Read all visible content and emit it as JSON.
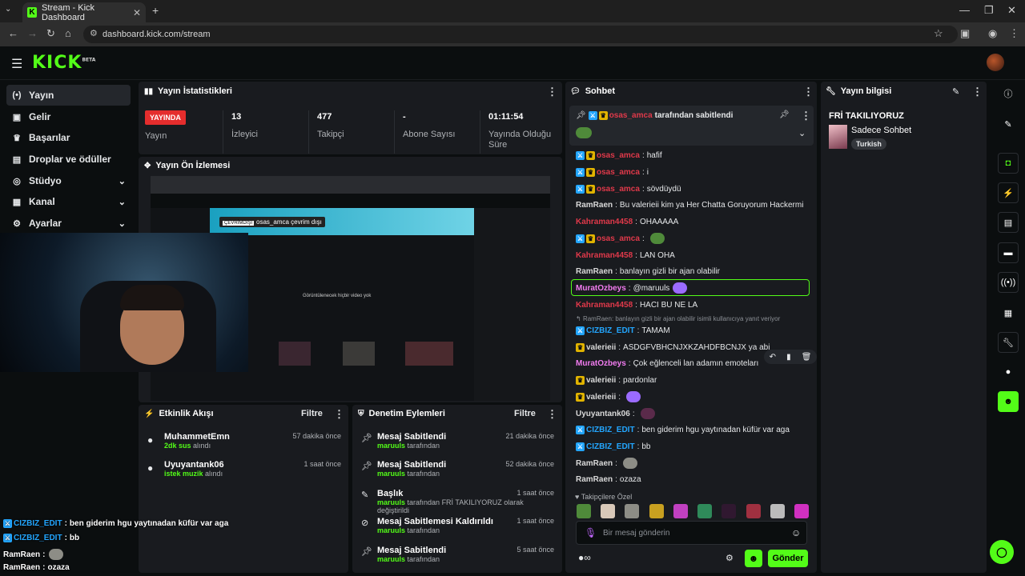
{
  "browser": {
    "tab_title": "Stream - Kick Dashboard",
    "url": "dashboard.kick.com/stream",
    "new_tab": "+"
  },
  "header": {
    "logo": "KICK",
    "logo_sup": "BETA"
  },
  "sidebar": {
    "items": [
      {
        "label": "Yayın",
        "icon": "broadcast-icon"
      },
      {
        "label": "Gelir",
        "icon": "revenue-icon"
      },
      {
        "label": "Başarılar",
        "icon": "trophy-icon"
      },
      {
        "label": "Droplar ve ödüller",
        "icon": "gift-icon"
      },
      {
        "label": "Stüdyo",
        "icon": "studio-icon"
      },
      {
        "label": "Kanal",
        "icon": "channel-icon"
      },
      {
        "label": "Ayarlar",
        "icon": "settings-icon"
      }
    ]
  },
  "stats": {
    "title": "Yayın İstatistikleri",
    "status_badge": "YAYINDA",
    "status_label": "Yayın",
    "items": [
      {
        "value": "13",
        "label": "İzleyici"
      },
      {
        "value": "477",
        "label": "Takipçi"
      },
      {
        "value": "-",
        "label": "Abone Sayısı"
      },
      {
        "value": "01:11:54",
        "label": "Yayında Olduğu Süre"
      }
    ]
  },
  "preview": {
    "title": "Yayın Ön İzlemesi",
    "offline_text": "osas_amca çevrim dışı",
    "offline_tag": "ÇEVRİMDIŞI",
    "no_video": "Görüntülenecek hiçbir video yok"
  },
  "activity": {
    "title": "Etkinlik Akışı",
    "filter": "Filtre",
    "items": [
      {
        "name": "MuhammetEmn",
        "amount": "2dk sus",
        "suffix": "alındı",
        "time": "57 dakika önce"
      },
      {
        "name": "Uyuyantank06",
        "amount": "istek muzik",
        "suffix": "alındı",
        "time": "1 saat önce"
      }
    ]
  },
  "moderation": {
    "title": "Denetim Eylemleri",
    "filter": "Filtre",
    "items": [
      {
        "action": "Mesaj Sabitlendi",
        "user": "maruuls",
        "suffix": "tarafından",
        "time": "21 dakika önce"
      },
      {
        "action": "Mesaj Sabitlendi",
        "user": "maruuls",
        "suffix": "tarafından",
        "time": "52 dakika önce"
      },
      {
        "action": "Başlık",
        "user": "maruuls",
        "suffix": "tarafından FRİ TAKILIYORUZ olarak değiştirildi",
        "time": "1 saat önce"
      },
      {
        "action": "Mesaj Sabitlemesi Kaldırıldı",
        "user": "maruuls",
        "suffix": "tarafından",
        "time": "1 saat önce"
      },
      {
        "action": "Mesaj Sabitlendi",
        "user": "maruuls",
        "suffix": "tarafından",
        "time": "5 saat önce"
      }
    ]
  },
  "chat": {
    "title": "Sohbet",
    "pinned_by": "osas_amca",
    "pinned_suffix": "tarafından sabitlendi",
    "messages": [
      {
        "user": "osas_amca",
        "color": "#e0394a",
        "mod": true,
        "sub": true,
        "text": "hafif"
      },
      {
        "user": "osas_amca",
        "color": "#e0394a",
        "mod": true,
        "sub": true,
        "text": "i"
      },
      {
        "user": "osas_amca",
        "color": "#e0394a",
        "mod": true,
        "sub": true,
        "text": "sövdüydü"
      },
      {
        "user": "RamRaen",
        "color": "#d9d9d9",
        "mod": false,
        "sub": false,
        "text": "Bu valerieii kim ya Her Chatta Goruyorum Hackermi"
      },
      {
        "user": "Kahraman4458",
        "color": "#e0394a",
        "mod": false,
        "sub": false,
        "text": "OHAAAAA"
      },
      {
        "user": "osas_amca",
        "color": "#e0394a",
        "mod": true,
        "sub": true,
        "text": ""
      },
      {
        "user": "Kahraman4458",
        "color": "#e0394a",
        "mod": false,
        "sub": false,
        "text": "LAN OHA"
      },
      {
        "user": "RamRaen",
        "color": "#d9d9d9",
        "mod": false,
        "sub": false,
        "text": "banlayın gizli bir ajan olabilir"
      },
      {
        "user": "MuratOzbeys",
        "color": "#f27cf0",
        "mod": false,
        "sub": false,
        "text": "@maruuls"
      },
      {
        "user": "Kahraman4458",
        "color": "#e0394a",
        "mod": false,
        "sub": false,
        "text": "HACI BU NE LA"
      },
      {
        "user": "CIZBIZ_EDIT",
        "color": "#23a6ff",
        "mod": true,
        "sub": false,
        "text": "TAMAM"
      },
      {
        "user": "valerieii",
        "color": "#d9d9d9",
        "mod": false,
        "sub": true,
        "text": "ASDGFVBHCNJXKZAHDFBCNJX ya abi"
      },
      {
        "user": "MuratOzbeys",
        "color": "#f27cf0",
        "mod": false,
        "sub": false,
        "text": "Çok eğlenceli lan adamın emoteları"
      },
      {
        "user": "valerieii",
        "color": "#d9d9d9",
        "mod": false,
        "sub": true,
        "text": "pardonlar"
      },
      {
        "user": "valerieii",
        "color": "#d9d9d9",
        "mod": false,
        "sub": true,
        "text": ""
      },
      {
        "user": "Uyuyantank06",
        "color": "#d9d9d9",
        "mod": false,
        "sub": false,
        "text": ""
      },
      {
        "user": "CIZBIZ_EDIT",
        "color": "#23a6ff",
        "mod": true,
        "sub": false,
        "text": "ben giderim hgu yaytınadan küfür var aga"
      },
      {
        "user": "CIZBIZ_EDIT",
        "color": "#23a6ff",
        "mod": true,
        "sub": false,
        "text": "bb"
      },
      {
        "user": "RamRaen",
        "color": "#d9d9d9",
        "mod": false,
        "sub": false,
        "text": ""
      },
      {
        "user": "RamRaen",
        "color": "#d9d9d9",
        "mod": false,
        "sub": false,
        "text": "ozaza"
      }
    ],
    "reply_hint": "RamRaen: banlayın gizli bir ajan olabilir isimli kullanıcıya yanıt veriyor",
    "follower_only": "Takipçilere Özel",
    "input_placeholder": "Bir mesaj gönderin",
    "send": "Gönder"
  },
  "stream_info": {
    "title": "Yayın bilgisi",
    "stream_title": "FRİ TAKILIYORUZ",
    "category": "Sadece Sohbet",
    "language": "Turkish"
  },
  "overlay": {
    "lines": [
      {
        "user": "CIZBIZ_EDIT",
        "text": "ben giderim hgu yaytınadan küfür var aga"
      },
      {
        "user": "CIZBIZ_EDIT",
        "text": "bb"
      },
      {
        "user": "RamRaen",
        "text": ""
      },
      {
        "user": "RamRaen",
        "text": "ozaza"
      }
    ]
  }
}
